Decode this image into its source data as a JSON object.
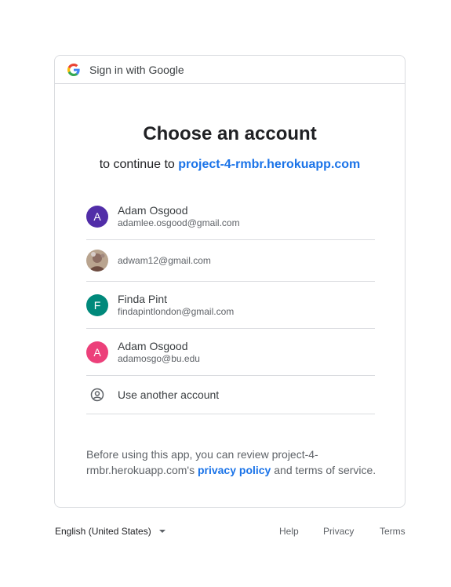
{
  "header": {
    "label": "Sign in with Google",
    "logo_icon": "google-g-icon"
  },
  "main": {
    "title": "Choose an account",
    "subtitle_prefix": "to continue to ",
    "app_name": "project-4-rmbr.herokuapp.com"
  },
  "accounts": [
    {
      "initial": "A",
      "name": "Adam Osgood",
      "email": "adamlee.osgood@gmail.com",
      "color": "#512da8"
    },
    {
      "initial": "",
      "name": "",
      "email": "adwam12@gmail.com",
      "color": "#8d6e63"
    },
    {
      "initial": "F",
      "name": "Finda Pint",
      "email": "findapintlondon@gmail.com",
      "color": "#00897b"
    },
    {
      "initial": "A",
      "name": "Adam Osgood",
      "email": "adamosgo@bu.edu",
      "color": "#ec407a"
    }
  ],
  "other_account": {
    "label": "Use another account",
    "icon": "account-circle-icon"
  },
  "disclaimer": {
    "line1": "Before using this app, you can review project-4-",
    "line2_prefix": "rmbr.herokuapp.com's ",
    "policy_link": "privacy policy",
    "line2_suffix": " and terms of service."
  },
  "footer": {
    "language": "English (United States)",
    "help": "Help",
    "privacy": "Privacy",
    "terms": "Terms"
  },
  "colors": {
    "accent": "#1a73e8",
    "border": "#dadce0"
  }
}
